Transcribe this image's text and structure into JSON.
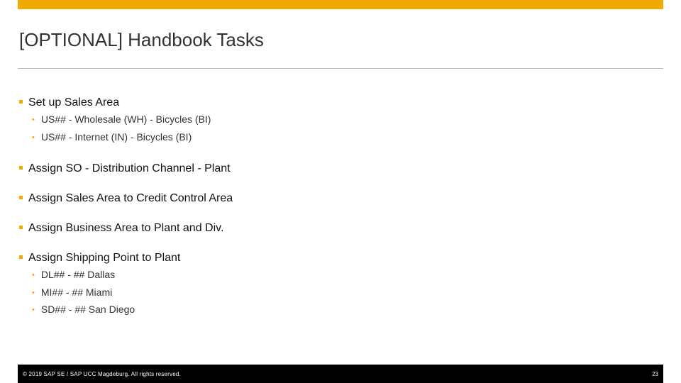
{
  "slide": {
    "title": "[OPTIONAL] Handbook Tasks",
    "accent_color": "#f0ab00",
    "items": [
      {
        "label": "Set up Sales Area",
        "subitems": [
          "US## - Wholesale (WH) - Bicycles (BI)",
          "US## - Internet (IN) - Bicycles (BI)"
        ]
      },
      {
        "label": "Assign SO - Distribution Channel - Plant",
        "subitems": []
      },
      {
        "label": "Assign Sales Area to Credit Control Area",
        "subitems": []
      },
      {
        "label": "Assign Business Area to Plant and Div.",
        "subitems": []
      },
      {
        "label": "Assign Shipping Point to Plant",
        "subitems": [
          "DL## - ## Dallas",
          "MI## - ## Miami",
          "SD## - ## San Diego"
        ]
      }
    ]
  },
  "footer": {
    "copyright": "© 2019 SAP SE / SAP UCC Magdeburg. All rights reserved.",
    "page_number": "23"
  }
}
